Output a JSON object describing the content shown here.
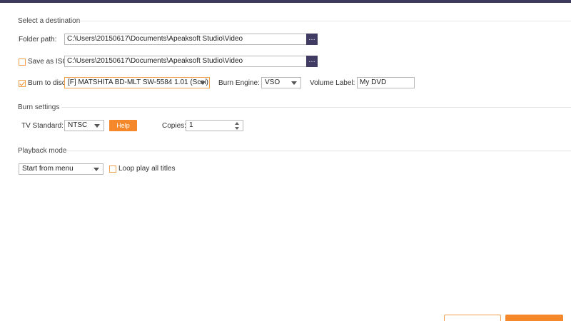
{
  "destination": {
    "section_title": "Select a destination",
    "folder_path": {
      "label": "Folder path:",
      "value": "C:\\Users\\20150617\\Documents\\Apeaksoft Studio\\Video",
      "browse": "…"
    },
    "save_as_iso": {
      "label": "Save as ISO",
      "checked": false,
      "value": "C:\\Users\\20150617\\Documents\\Apeaksoft Studio\\Video",
      "browse": "…"
    },
    "burn_to_disc": {
      "label": "Burn to disc",
      "checked": true,
      "drive": "[F] MATSHITA BD-MLT SW-5584 1.01 (Scsi)"
    },
    "burn_engine": {
      "label": "Burn Engine:",
      "value": "VSO"
    },
    "volume_label": {
      "label": "Volume Label:",
      "value": "My DVD"
    }
  },
  "burn_settings": {
    "section_title": "Burn settings",
    "tv_standard": {
      "label": "TV Standard:",
      "value": "NTSC"
    },
    "help_label": "Help",
    "copies": {
      "label": "Copies:",
      "value": "1"
    }
  },
  "playback": {
    "section_title": "Playback mode",
    "mode": "Start from menu",
    "loop_all": {
      "label": "Loop play all titles",
      "checked": false
    }
  },
  "colors": {
    "accent": "#f4882a",
    "header": "#3e3a5e"
  }
}
